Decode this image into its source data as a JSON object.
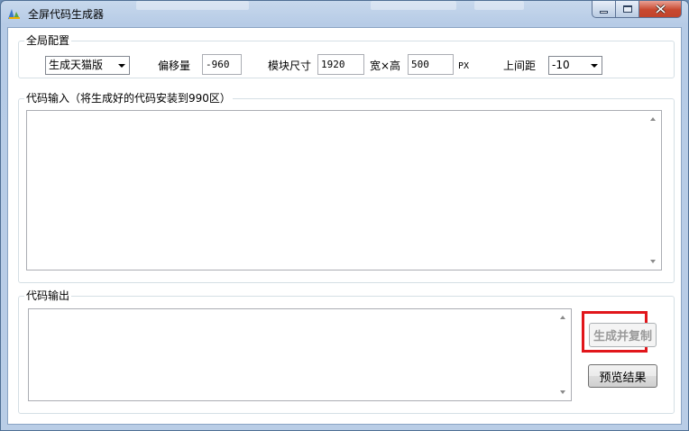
{
  "window": {
    "title": "全屏代码生成器"
  },
  "global_config": {
    "group_label": "全局配置",
    "version_select": {
      "value": "生成天猫版"
    },
    "offset_label": "偏移量",
    "offset_value": "-960",
    "module_size_label": "模块尺寸",
    "width_value": "1920",
    "width_height_label": "宽×高",
    "height_value": "500",
    "unit_label": "PX",
    "top_margin_label": "上间距",
    "top_margin_select": {
      "value": "-10"
    }
  },
  "code_input": {
    "group_label": "代码输入（将生成好的代码安装到990区）",
    "value": ""
  },
  "code_output": {
    "group_label": "代码输出",
    "value": "",
    "generate_button": "生成并复制",
    "preview_button": "预览结果"
  },
  "colors": {
    "highlight": "#e1161b",
    "title_bg": "#b6cbe6"
  }
}
